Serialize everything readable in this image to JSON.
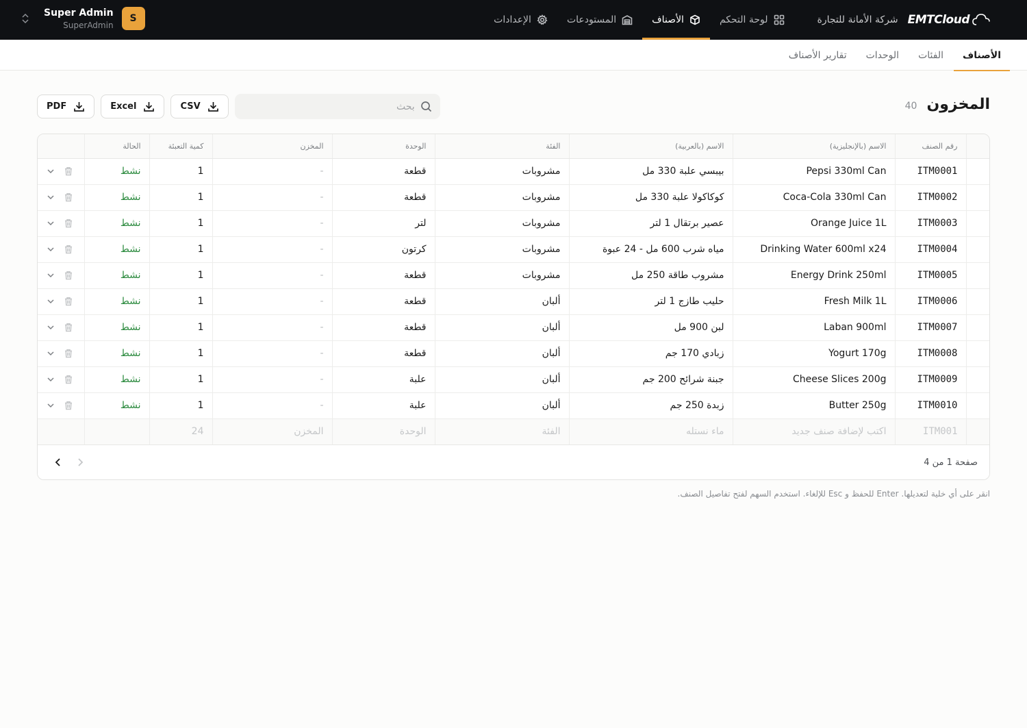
{
  "topbar": {
    "logo_text": "EMTCloud",
    "company": "شركة الأمانة للتجارة",
    "nav": [
      {
        "label": "لوحة التحكم",
        "icon": "dashboard-icon",
        "active": false
      },
      {
        "label": "الأصناف",
        "icon": "box-icon",
        "active": true
      },
      {
        "label": "المستودعات",
        "icon": "warehouse-icon",
        "active": false
      },
      {
        "label": "الإعدادات",
        "icon": "gear-icon",
        "active": false
      }
    ],
    "user": {
      "name": "Super Admin",
      "role": "SuperAdmin",
      "initial": "S"
    }
  },
  "subnav": [
    "الأصناف",
    "الفئات",
    "الوحدات",
    "تقارير الأصناف"
  ],
  "page": {
    "title": "المخزون",
    "count": "40"
  },
  "toolbar": {
    "search_placeholder": "بحث",
    "csv": "CSV",
    "excel": "Excel",
    "pdf": "PDF"
  },
  "table": {
    "headers": [
      "رقم الصنف",
      "الاسم (بالإنجليزية)",
      "الاسم (بالعربية)",
      "الفئة",
      "الوحدة",
      "المخزن",
      "كمية التعبئة",
      "الحالة"
    ],
    "rows": [
      [
        "ITM0001",
        "Pepsi 330ml Can",
        "بيبسي علبة 330 مل",
        "مشروبات",
        "قطعة",
        "-",
        "1",
        "نشط"
      ],
      [
        "ITM0002",
        "Coca-Cola 330ml Can",
        "كوكاكولا علبة 330 مل",
        "مشروبات",
        "قطعة",
        "-",
        "1",
        "نشط"
      ],
      [
        "ITM0003",
        "Orange Juice 1L",
        "عصير برتقال 1 لتر",
        "مشروبات",
        "لتر",
        "-",
        "1",
        "نشط"
      ],
      [
        "ITM0004",
        "Drinking Water 600ml x24",
        "مياه شرب 600 مل - 24 عبوة",
        "مشروبات",
        "كرتون",
        "-",
        "1",
        "نشط"
      ],
      [
        "ITM0005",
        "Energy Drink 250ml",
        "مشروب طاقة 250 مل",
        "مشروبات",
        "قطعة",
        "-",
        "1",
        "نشط"
      ],
      [
        "ITM0006",
        "Fresh Milk 1L",
        "حليب طازج 1 لتر",
        "ألبان",
        "قطعة",
        "-",
        "1",
        "نشط"
      ],
      [
        "ITM0007",
        "Laban 900ml",
        "لبن 900 مل",
        "ألبان",
        "قطعة",
        "-",
        "1",
        "نشط"
      ],
      [
        "ITM0008",
        "Yogurt 170g",
        "زبادي 170 جم",
        "ألبان",
        "قطعة",
        "-",
        "1",
        "نشط"
      ],
      [
        "ITM0009",
        "Cheese Slices 200g",
        "جبنة شرائح 200 جم",
        "ألبان",
        "علبة",
        "-",
        "1",
        "نشط"
      ],
      [
        "ITM0010",
        "Butter 250g",
        "زبدة 250 جم",
        "ألبان",
        "علبة",
        "-",
        "1",
        "نشط"
      ]
    ],
    "new_row": [
      "ITM001",
      "اكتب لإضافة صنف جديد",
      "ماء نستله",
      "الفئة",
      "الوحدة",
      "المخزن",
      "24"
    ],
    "pager_text": "صفحة 1 من 4"
  },
  "hint": "انقر على أي خلية لتعديلها. Enter للحفظ و Esc للإلغاء. استخدم السهم لفتح تفاصيل الصنف.",
  "colors": {
    "accent": "#e9a23b",
    "status_active": "#2b8a3e",
    "topbar_bg": "#0f1114"
  }
}
